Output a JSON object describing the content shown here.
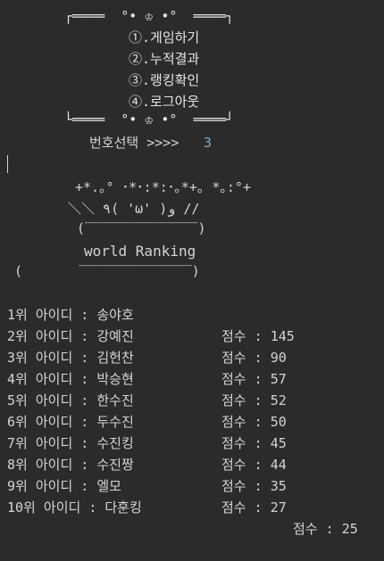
{
  "window": {
    "background": "#2b2b2b"
  },
  "banner": {
    "top": "┌════  °• ♔ •°  ════┐",
    "bottom": "└════  °• ♔ •°  ════┘"
  },
  "menu": {
    "items": [
      {
        "label": "①.게임하기"
      },
      {
        "label": "②.누적결과"
      },
      {
        "label": "③.랭킹확인"
      },
      {
        "label": "④.로그아웃"
      }
    ]
  },
  "prompt": {
    "label": "번호선택 >>>>",
    "value": "3"
  },
  "art": {
    "line1": "+*.｡° ･*･:*:･｡*+｡ *｡:°+",
    "line2": "＼＼ ٩( 'ω' )و //",
    "line3": "(‾‾‾‾‾‾‾‾‾‾‾‾‾‾)",
    "title": "world Ranking",
    "line5": "(       ‾‾‾‾‾‾‾‾‾‾‾‾‾‾)"
  },
  "ranking": {
    "rows": [
      {
        "left": "1위 아이디 : 송야호",
        "score": "점수 : 145"
      },
      {
        "left": "2위 아이디 : 강예진",
        "score": "점수 : 90"
      },
      {
        "left": "3위 아이디 : 김헌찬",
        "score": "점수 : 57"
      },
      {
        "left": "4위 아이디 : 박승현",
        "score": "점수 : 52"
      },
      {
        "left": "5위 아이디 : 한수진",
        "score": "점수 : 50"
      },
      {
        "left": "6위 아이디 : 두수진",
        "score": "점수 : 45"
      },
      {
        "left": "7위 아이디 : 수진킹",
        "score": "점수 : 44"
      },
      {
        "left": "8위 아이디 : 수진짱",
        "score": "점수 : 35"
      },
      {
        "left": "9위 아이디 : 엘모",
        "score": "점수 : 27"
      },
      {
        "left": "10위 아이디 : 다훈킹",
        "score": "점수 : 25"
      }
    ]
  }
}
